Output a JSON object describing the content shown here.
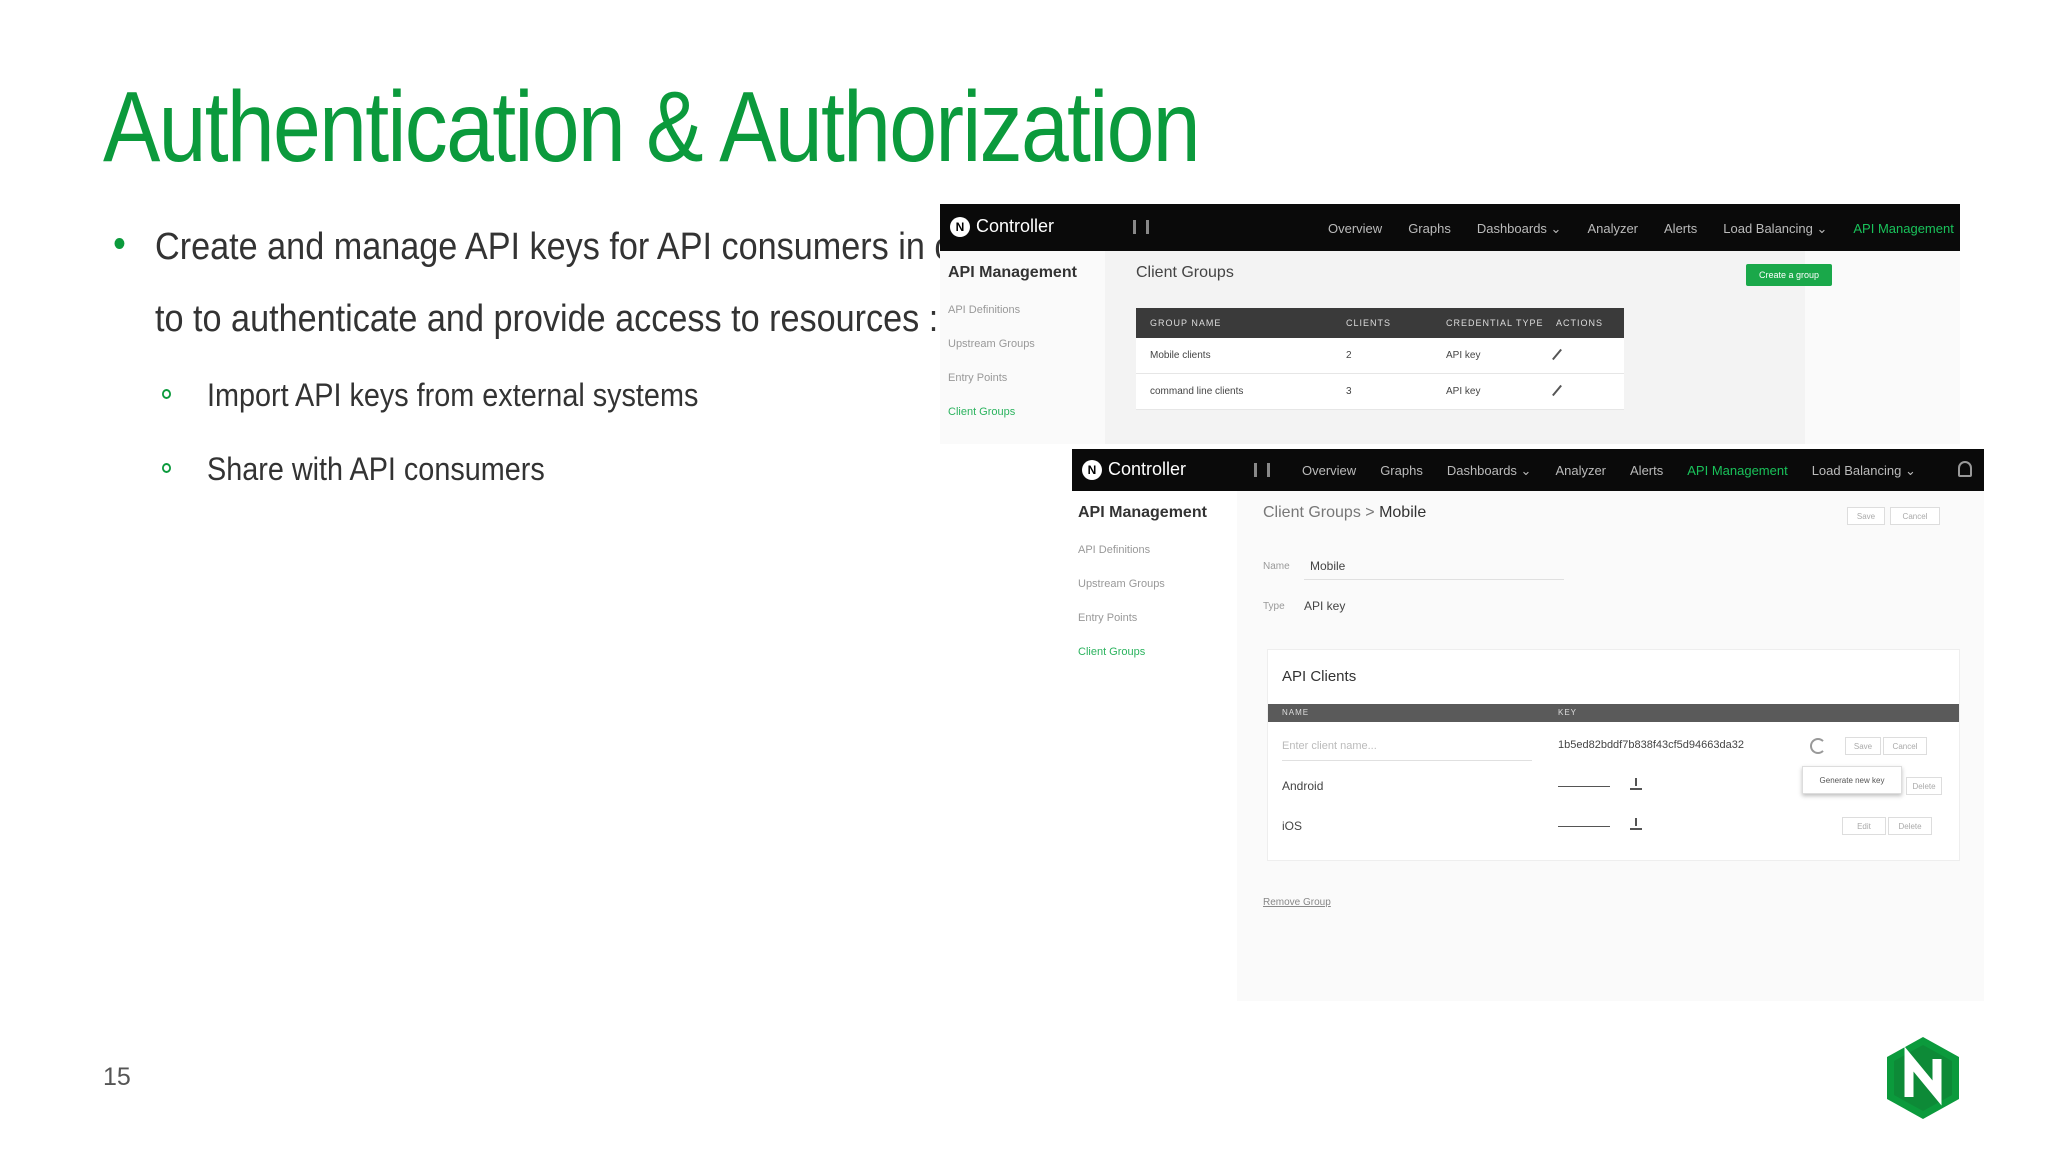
{
  "slide": {
    "title": "Authentication & Authorization",
    "bullets": {
      "main_line1": "Create and manage API keys for API consumers in order",
      "main_line2": "to to authenticate and provide access to resources :",
      "sub1": "Import API keys from external systems",
      "sub2": "Share with API consumers"
    },
    "page_number": "15",
    "accent_color": "#0b9a3c",
    "logo_letter": "N"
  },
  "shot1": {
    "brand": "Controller",
    "nav": [
      "Overview",
      "Graphs",
      "Dashboards ⌄",
      "Analyzer",
      "Alerts",
      "Load Balancing ⌄",
      "API Management"
    ],
    "sidebar_title": "API Management",
    "sidebar_items": [
      "API Definitions",
      "Upstream Groups",
      "Entry Points",
      "Client Groups"
    ],
    "page_heading": "Client Groups",
    "create_button": "Create a group",
    "table_headers": [
      "GROUP NAME",
      "CLIENTS",
      "CREDENTIAL TYPE",
      "ACTIONS"
    ],
    "rows": [
      {
        "name": "Mobile clients",
        "clients": "2",
        "type": "API key"
      },
      {
        "name": "command line clients",
        "clients": "3",
        "type": "API key"
      }
    ]
  },
  "shot2": {
    "brand": "Controller",
    "nav": [
      "Overview",
      "Graphs",
      "Dashboards ⌄",
      "Analyzer",
      "Alerts",
      "API Management",
      "Load Balancing ⌄"
    ],
    "sidebar_title": "API Management",
    "sidebar_items": [
      "API Definitions",
      "Upstream Groups",
      "Entry Points",
      "Client Groups"
    ],
    "breadcrumb_parent": "Client Groups",
    "breadcrumb_sep": ">",
    "breadcrumb_current": "Mobile",
    "save_label": "Save",
    "cancel_label": "Cancel",
    "name_label": "Name",
    "name_value": "Mobile",
    "type_label": "Type",
    "type_value": "API key",
    "clients_title": "API Clients",
    "clients_headers": [
      "NAME",
      "KEY"
    ],
    "new_client_placeholder": "Enter client name...",
    "new_client_key": "1b5ed82bddf7b838f43cf5d94663da32",
    "new_save": "Save",
    "new_cancel": "Cancel",
    "tooltip": "Generate new key",
    "clients": [
      {
        "name": "Android",
        "edit": "Edit",
        "delete": "Delete"
      },
      {
        "name": "iOS",
        "edit": "Edit",
        "delete": "Delete"
      }
    ],
    "remove_group": "Remove Group"
  }
}
